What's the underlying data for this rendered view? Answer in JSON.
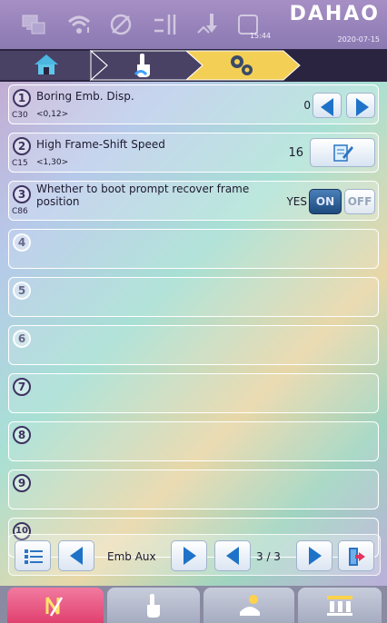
{
  "brand": {
    "name": "DAHAO",
    "time": "15:44",
    "date": "2020-07-15"
  },
  "status_icons": [
    "monitor-icon",
    "wifi-icon",
    "no-spindle-icon",
    "thread-tension-icon",
    "needle-down-icon",
    "blank-box-icon"
  ],
  "breadcrumb": [
    "home-icon",
    "hand-icon",
    "gears-icon"
  ],
  "rows": [
    {
      "num": "1",
      "code": "C30",
      "title": "Boring Emb. Disp.",
      "range": "<0,12>",
      "value": "0",
      "control": "arrows"
    },
    {
      "num": "2",
      "code": "C15",
      "title": "High Frame-Shift Speed",
      "range": "<1,30>",
      "value": "16",
      "control": "edit"
    },
    {
      "num": "3",
      "code": "C86",
      "title": "Whether to boot prompt recover frame position",
      "range": "",
      "value": "YES",
      "control": "toggle",
      "on": "ON",
      "off": "OFF"
    },
    {
      "num": "4"
    },
    {
      "num": "5"
    },
    {
      "num": "6"
    },
    {
      "num": "7"
    },
    {
      "num": "8"
    },
    {
      "num": "9"
    },
    {
      "num": "10"
    }
  ],
  "nav": {
    "category": "Emb Aux",
    "page": "3 / 3"
  },
  "tabs": [
    "no-stitch-tab",
    "hand-tab",
    "operator-tab",
    "needles-tab"
  ],
  "colors": {
    "statusbar": "#9a86bd",
    "active_crumb": "#f4cf55",
    "tab_active": "#ec5c87",
    "tab": "#b8bdcc"
  }
}
